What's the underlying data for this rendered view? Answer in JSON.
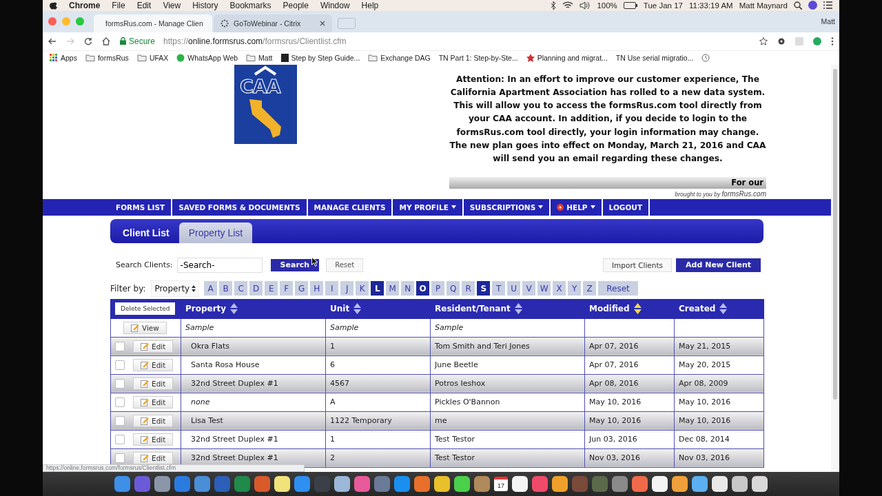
{
  "menubar": {
    "app": "Chrome",
    "menus": [
      "File",
      "Edit",
      "View",
      "History",
      "Bookmarks",
      "People",
      "Window",
      "Help"
    ],
    "battery": "100%",
    "date": "Tue Jan 17",
    "time": "11:33:19 AM",
    "user": "Matt Maynard"
  },
  "tabs": [
    {
      "title": "formsRus.com - Manage Clien",
      "selected": true
    },
    {
      "title": "GoToWebinar - Citrix",
      "selected": false
    }
  ],
  "profile": "Matt",
  "address": {
    "secure": "Secure",
    "scheme": "https://",
    "host": "online.formsrus.com",
    "path": "/formsrus/Clientlist.cfm"
  },
  "bookmarks": [
    {
      "kind": "apps",
      "label": "Apps"
    },
    {
      "kind": "folder",
      "label": "formsRus"
    },
    {
      "kind": "folder",
      "label": "UFAX"
    },
    {
      "kind": "chat",
      "label": "WhatsApp Web"
    },
    {
      "kind": "folder",
      "label": "Matt"
    },
    {
      "kind": "page",
      "label": "Step by Step Guide..."
    },
    {
      "kind": "folder",
      "label": "Exchange DAG"
    },
    {
      "kind": "text",
      "label": "TN Part 1: Step-by-Ste..."
    },
    {
      "kind": "star",
      "label": "Planning and migrat..."
    },
    {
      "kind": "text",
      "label": "TN Use serial migratio..."
    },
    {
      "kind": "history"
    }
  ],
  "logo": {
    "text": "CAA"
  },
  "notice": "Attention: In an effort to improve our customer experience, The California Apartment Association has rolled to a new data system. This will allow you to access the formsRus.com tool directly from your CAA account. In addition, if you decide to login to the formsRus.com tool directly, your login information may change. The new plan goes into effect on Monday, March 21, 2016 and CAA will send you an email regarding these changes.",
  "banner": "For our",
  "credit": {
    "prefix": "brought to you by",
    "brand": "formsRus.com"
  },
  "nav": [
    {
      "label": "FORMS LIST",
      "dropdown": false,
      "help_icon": false
    },
    {
      "label": "SAVED FORMS & DOCUMENTS",
      "dropdown": false,
      "help_icon": false
    },
    {
      "label": "MANAGE CLIENTS",
      "dropdown": false,
      "help_icon": false
    },
    {
      "label": "MY PROFILE",
      "dropdown": true,
      "help_icon": false
    },
    {
      "label": "SUBSCRIPTIONS",
      "dropdown": true,
      "help_icon": false
    },
    {
      "label": "HELP",
      "dropdown": true,
      "help_icon": true
    },
    {
      "label": "LOGOUT",
      "dropdown": false,
      "help_icon": false
    }
  ],
  "subtabs": [
    {
      "label": "Client List",
      "selected": true
    },
    {
      "label": "Property List",
      "selected": false
    }
  ],
  "search": {
    "label": "Search Clients:",
    "value": "-Search-",
    "search_button": "Search",
    "reset_button": "Reset",
    "import_button": "Import Clients",
    "add_button": "Add New Client"
  },
  "filter": {
    "label": "Filter by:",
    "field": "Property",
    "reset": "Reset",
    "letters": [
      {
        "letter": "A",
        "selected": false
      },
      {
        "letter": "B",
        "selected": false
      },
      {
        "letter": "C",
        "selected": false
      },
      {
        "letter": "D",
        "selected": false
      },
      {
        "letter": "E",
        "selected": false
      },
      {
        "letter": "F",
        "selected": false
      },
      {
        "letter": "G",
        "selected": false
      },
      {
        "letter": "H",
        "selected": false
      },
      {
        "letter": "I",
        "selected": false
      },
      {
        "letter": "J",
        "selected": false
      },
      {
        "letter": "K",
        "selected": false
      },
      {
        "letter": "L",
        "selected": true
      },
      {
        "letter": "M",
        "selected": false
      },
      {
        "letter": "N",
        "selected": false
      },
      {
        "letter": "O",
        "selected": true
      },
      {
        "letter": "P",
        "selected": false
      },
      {
        "letter": "Q",
        "selected": false
      },
      {
        "letter": "R",
        "selected": false
      },
      {
        "letter": "S",
        "selected": true
      },
      {
        "letter": "T",
        "selected": false
      },
      {
        "letter": "U",
        "selected": false
      },
      {
        "letter": "V",
        "selected": false
      },
      {
        "letter": "W",
        "selected": false
      },
      {
        "letter": "X",
        "selected": false
      },
      {
        "letter": "Y",
        "selected": false
      },
      {
        "letter": "Z",
        "selected": false
      }
    ]
  },
  "table": {
    "delete_button": "Delete Selected",
    "columns": [
      {
        "label": "Property",
        "sorted": false
      },
      {
        "label": "Unit",
        "sorted": false
      },
      {
        "label": "Resident/Tenant",
        "sorted": false
      },
      {
        "label": "Modified",
        "sorted": true
      },
      {
        "label": "Created",
        "sorted": false
      }
    ],
    "sample": {
      "action": "View",
      "cells": [
        "Sample",
        "Sample",
        "Sample"
      ]
    },
    "rows": [
      {
        "action": "Edit",
        "checked": false,
        "property_missing": false,
        "cells": [
          "Okra Flats",
          "1",
          "Tom Smith and Teri Jones",
          "Apr 07, 2016",
          "May 21, 2015"
        ]
      },
      {
        "action": "Edit",
        "checked": false,
        "property_missing": false,
        "cells": [
          "Santa Rosa House",
          "6",
          "June Beetle",
          "Apr 07, 2016",
          "May 20, 2015"
        ]
      },
      {
        "action": "Edit",
        "checked": false,
        "property_missing": false,
        "cells": [
          "32nd Street Duplex #1",
          "4567",
          "Potros Ieshox",
          "Apr 08, 2016",
          "Apr 08, 2009"
        ]
      },
      {
        "action": "Edit",
        "checked": false,
        "property_missing": true,
        "cells": [
          "none",
          "A",
          "Pickles O'Bannon",
          "May 10, 2016",
          "May 10, 2016"
        ]
      },
      {
        "action": "Edit",
        "checked": false,
        "property_missing": false,
        "cells": [
          "Lisa Test",
          "1122 Temporary",
          "me",
          "May 10, 2016",
          "May 10, 2016"
        ]
      },
      {
        "action": "Edit",
        "checked": false,
        "property_missing": false,
        "cells": [
          "32nd Street Duplex #1",
          "1",
          "Test Testor",
          "Jun 03, 2016",
          "Dec 08, 2014"
        ]
      },
      {
        "action": "Edit",
        "checked": false,
        "property_missing": false,
        "cells": [
          "32nd Street Duplex #1",
          "2",
          "Test Testor",
          "Nov 03, 2016",
          "Nov 03, 2016"
        ]
      }
    ]
  },
  "status_url": "https://online.formsrus.com/formsrus/Clientlist.cfm",
  "dock": {
    "calendar_day": "17"
  }
}
